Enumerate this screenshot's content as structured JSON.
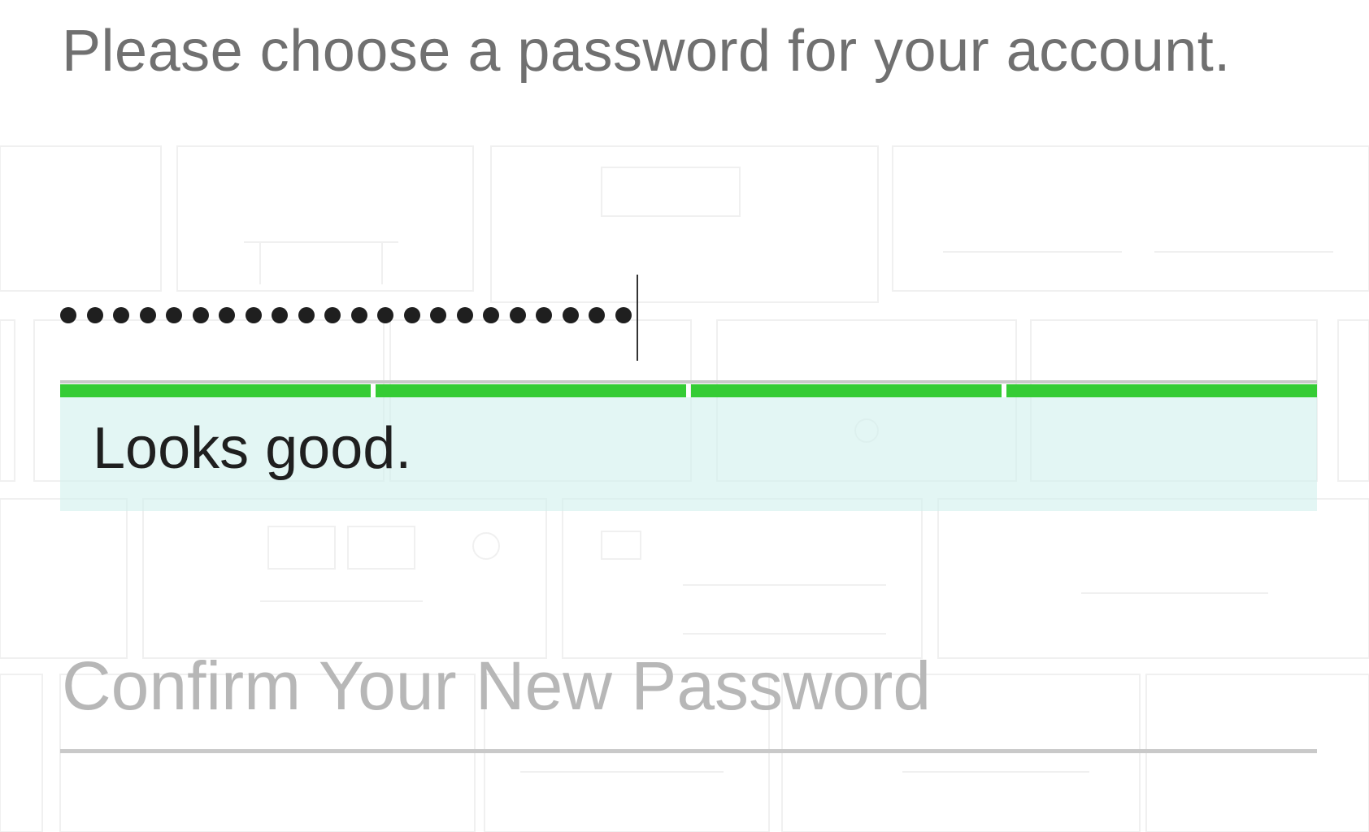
{
  "header": {
    "instruction": "Please choose a password for your account."
  },
  "password": {
    "masked_value": "•••••••••••••••••••••••",
    "character_count": 22
  },
  "strength": {
    "filled_segments": 4,
    "total_segments": 4,
    "color": "#35cc35",
    "message": "Looks good."
  },
  "confirm": {
    "placeholder": "Confirm Your New Password"
  }
}
